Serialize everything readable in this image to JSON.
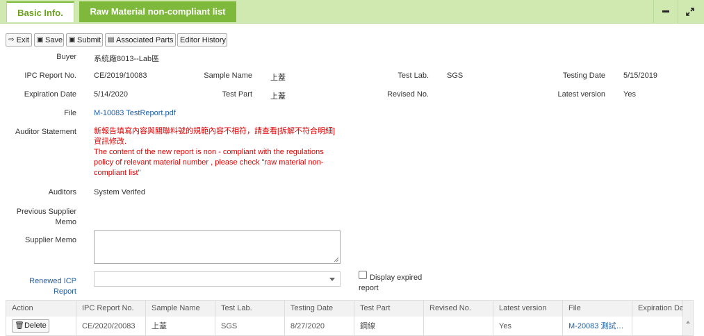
{
  "tabs": {
    "basic": "Basic Info.",
    "raw": "Raw Material non-compliant list"
  },
  "toolbar": {
    "exit": "Exit",
    "save": "Save",
    "submit": "Submit",
    "parts": "Associated Parts",
    "history": "Editor History"
  },
  "form": {
    "buyer_label": "Buyer",
    "buyer": "系統廠8013--Lab區",
    "ipc_label": "IPC Report No.",
    "ipc": "CE/2019/10083",
    "sample_label": "Sample Name",
    "sample": "上蓋",
    "testlab_label": "Test Lab.",
    "testlab": "SGS",
    "testdate_label": "Testing Date",
    "testdate": "5/15/2019",
    "expire_label": "Expiration Date",
    "expire": "5/14/2020",
    "testpart_label": "Test Part",
    "testpart": "上蓋",
    "revised_label": "Revised No.",
    "revised": "",
    "latest_label": "Latest version",
    "latest": "Yes",
    "file_label": "File",
    "file": "M-10083 TestReport.pdf",
    "auditor_stmt_label": "Auditor Statement",
    "auditor_stmt_zh_1": "新報告填寫內容與關聯料號的規範內容不相符，請查看[拆解不符合明細]",
    "auditor_stmt_zh_2": "資訊修改.",
    "auditor_stmt_en_1": "The content of the new report is non - compliant with the regulations",
    "auditor_stmt_en_2": "policy of relevant material number  , please check \"raw material non-",
    "auditor_stmt_en_3": "compliant list\"",
    "auditors_label": "Auditors",
    "auditors": "System Verifed",
    "prev_memo_label_1": "Previous Supplier",
    "prev_memo_label_2": "Memo",
    "supplier_memo_label": "Supplier Memo",
    "renewed_label_1": "Renewed ICP",
    "renewed_label_2": "Report",
    "display_expired_1": "Display expired",
    "display_expired_2": "report"
  },
  "table": {
    "headers": [
      "Action",
      "IPC Report No.",
      "Sample Name",
      "Test Lab.",
      "Testing Date",
      "Test Part",
      "Revised No.",
      "Latest version",
      "File",
      "Expiration Da"
    ],
    "row": {
      "delete": "Delete",
      "ipc": "CE/2020/20083",
      "sample": "上蓋",
      "lab": "SGS",
      "date": "8/27/2020",
      "part": "鋼線",
      "revised": "",
      "latest": "Yes",
      "file": "M-20083 測試…",
      "expiration": ""
    }
  }
}
